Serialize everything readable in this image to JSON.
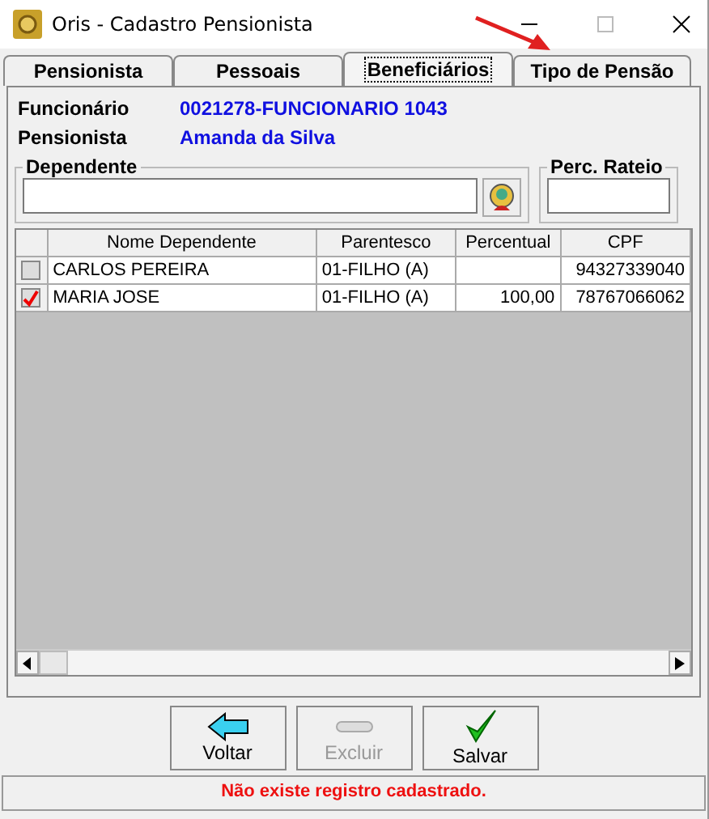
{
  "window": {
    "title": "Oris - Cadastro Pensionista"
  },
  "tabs": [
    {
      "label": "Pensionista",
      "selected": false
    },
    {
      "label": "Pessoais",
      "selected": false
    },
    {
      "label": "Beneficiários",
      "selected": true
    },
    {
      "label": "Tipo de Pensão",
      "selected": false
    }
  ],
  "info": [
    {
      "label": "Funcionário",
      "value": "0021278-FUNCIONARIO 1043"
    },
    {
      "label": "Pensionista",
      "value": "Amanda da Silva"
    }
  ],
  "dependente": {
    "label": "Dependente"
  },
  "perc_rateio": {
    "label": "Perc. Rateio"
  },
  "table": {
    "columns": [
      "Nome Dependente",
      "Parentesco",
      "Percentual",
      "CPF"
    ],
    "rows": [
      {
        "checked": false,
        "cells": [
          "CARLOS PEREIRA",
          "01-FILHO (A)",
          "",
          "94327339040"
        ]
      },
      {
        "checked": true,
        "cells": [
          "MARIA JOSE",
          "01-FILHO (A)",
          "100,00",
          "78767066062"
        ]
      }
    ]
  },
  "buttons": [
    {
      "kind": "back",
      "label": "Voltar",
      "disabled": false
    },
    {
      "kind": "delete",
      "label": "Excluir",
      "disabled": true
    },
    {
      "kind": "save",
      "label": "Salvar",
      "disabled": false
    }
  ],
  "status_bar": "Não existe registro cadastrado."
}
